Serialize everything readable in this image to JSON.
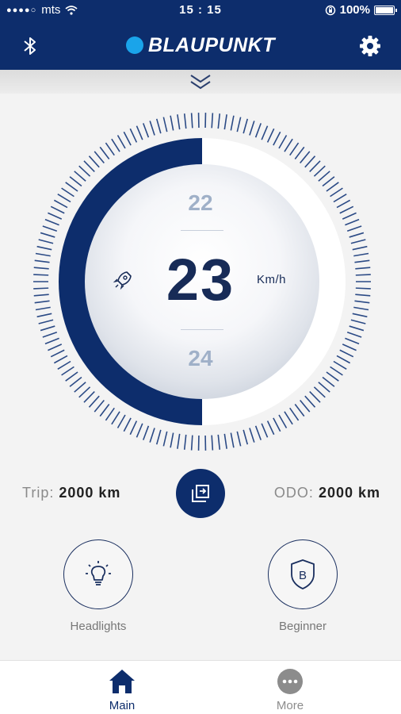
{
  "status": {
    "carrier": "mts",
    "time": "15 : 15",
    "battery_percent": "100%",
    "battery_level": 1.0
  },
  "nav": {
    "brand": "BLAUPUNKT",
    "brand_color": "#0d2d6c",
    "accent_color": "#1aa4ea"
  },
  "speed": {
    "current": "23",
    "previous": "22",
    "next": "24",
    "unit": "Km/h",
    "gauge_fill_fraction": 0.5
  },
  "odometer": {
    "trip_label": "Trip:",
    "trip_value": "2000 km",
    "odo_label": "ODO:",
    "odo_value": "2000 km"
  },
  "actions": {
    "headlights_label": "Headlights",
    "mode_label": "Beginner"
  },
  "tabs": [
    {
      "label": "Main",
      "icon": "home-icon",
      "active": true
    },
    {
      "label": "More",
      "icon": "more-icon",
      "active": false
    }
  ]
}
